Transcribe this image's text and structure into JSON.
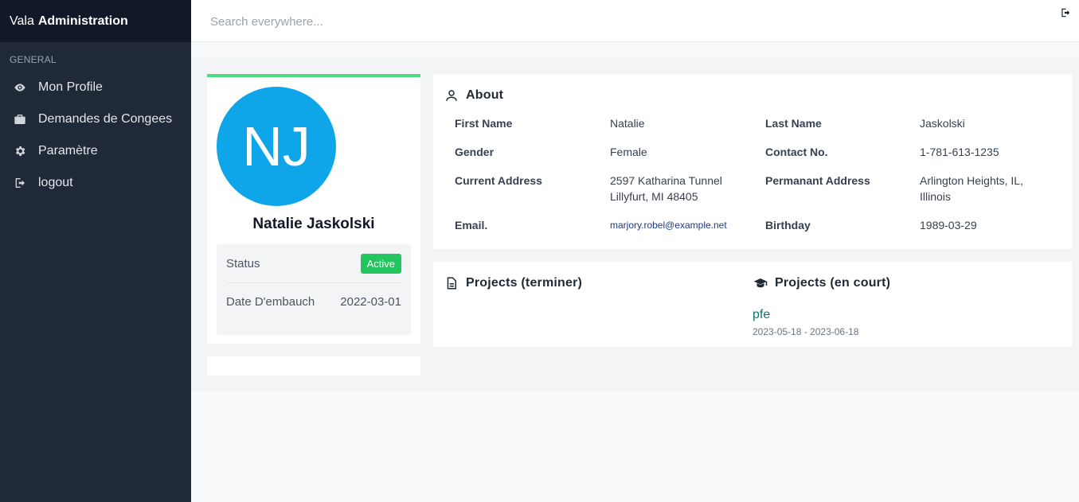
{
  "brand": {
    "prefix": "Vala",
    "name": "Administration"
  },
  "sidebar": {
    "section": "GENERAL",
    "items": [
      {
        "label": "Mon Profile",
        "icon": "eye-icon"
      },
      {
        "label": "Demandes de Congees",
        "icon": "briefcase-icon"
      },
      {
        "label": "Paramètre",
        "icon": "gear-icon"
      },
      {
        "label": "logout",
        "icon": "sign-out-icon"
      }
    ]
  },
  "search": {
    "placeholder": "Search everywhere..."
  },
  "profile": {
    "initials": "NJ",
    "name": "Natalie Jaskolski",
    "status_label": "Status",
    "status_value": "Active",
    "hire_label": "Date D'embauch",
    "hire_value": "2022-03-01"
  },
  "about": {
    "title": "About",
    "first_name_label": "First Name",
    "first_name": "Natalie",
    "last_name_label": "Last Name",
    "last_name": "Jaskolski",
    "gender_label": "Gender",
    "gender": "Female",
    "contact_label": "Contact No.",
    "contact": "1-781-613-1235",
    "current_address_label": "Current Address",
    "current_address_line1": "2597 Katharina Tunnel",
    "current_address_line2": "Lillyfurt, MI 48405",
    "permanent_address_label": "Permanant Address",
    "permanent_address_line1": "Arlington Heights, IL,",
    "permanent_address_line2": "Illinois",
    "email_label": "Email.",
    "email": "marjory.robel@example.net",
    "birthday_label": "Birthday",
    "birthday": "1989-03-29"
  },
  "projects": {
    "done_title": "Projects (terminer)",
    "current_title": "Projects (en court)",
    "current": [
      {
        "name": "pfe",
        "dates": "2023-05-18 - 2023-06-18"
      }
    ]
  },
  "colors": {
    "sidebar": "#1f2937",
    "accent_green": "#22c55e",
    "avatar_blue": "#0ea5e9",
    "link_teal": "#0f766e"
  }
}
